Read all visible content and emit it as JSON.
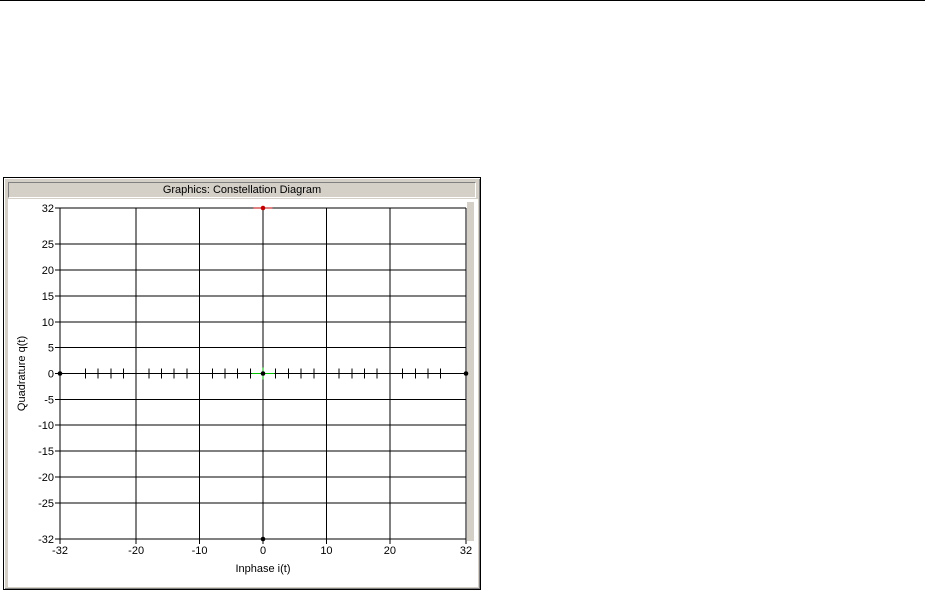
{
  "window": {
    "title": "Graphics: Constellation Diagram"
  },
  "chart_data": {
    "type": "scatter",
    "title": "Graphics: Constellation Diagram",
    "xlabel": "Inphase i(t)",
    "ylabel": "Quadrature q(t)",
    "xlim": [
      -32,
      32
    ],
    "ylim": [
      -32,
      32
    ],
    "xticks": [
      "-32",
      "-20",
      "-10",
      "0",
      "10",
      "20",
      "32"
    ],
    "yticks": [
      "32",
      "25",
      "20",
      "15",
      "10",
      "5",
      "0",
      "-5",
      "-10",
      "-15",
      "-20",
      "-25",
      "-32"
    ],
    "grid": true,
    "points": [
      {
        "x": 0,
        "y": 32,
        "color": "#c00000"
      },
      {
        "x": 0,
        "y": 0,
        "color": "#000000"
      },
      {
        "x": -32,
        "y": 0,
        "color": "#000000"
      },
      {
        "x": 32,
        "y": 0,
        "color": "#000000"
      },
      {
        "x": 0,
        "y": -32,
        "color": "#000000"
      }
    ],
    "colors": {
      "grid": "#000000",
      "highlight": "#00c000",
      "marker_red": "#c00000"
    }
  }
}
